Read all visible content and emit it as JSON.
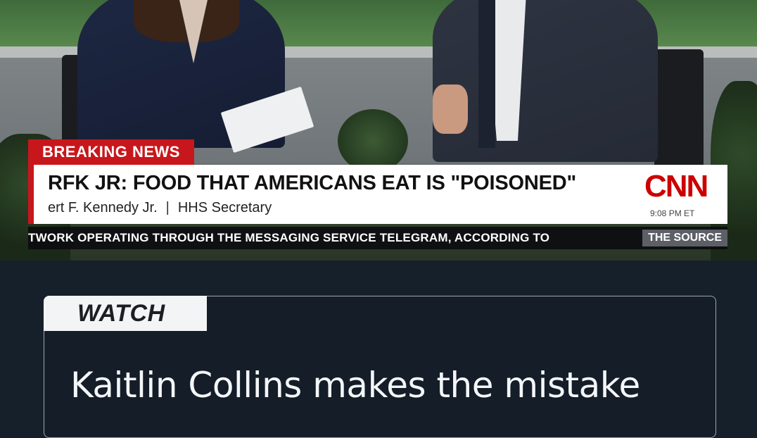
{
  "broadcast": {
    "breaking_tag": "BREAKING NEWS",
    "headline": "RFK JR: FOOD THAT AMERICANS EAT IS \"POISONED\"",
    "guest_name": "ert F. Kennedy Jr.",
    "separator": "|",
    "guest_title": "HHS Secretary",
    "network_logo": "CNN",
    "time": "9:08 PM ET",
    "ticker": "TWORK OPERATING THROUGH THE MESSAGING SERVICE TELEGRAM, ACCORDING TO",
    "ticker_source": "THE SOURCE"
  },
  "card": {
    "tab_label": "WATCH",
    "caption_line1": "Kaitlin Collins makes the mistake"
  },
  "colors": {
    "breaking_red": "#c8171c",
    "cnn_red": "#cc0000",
    "background": "#16202b"
  }
}
